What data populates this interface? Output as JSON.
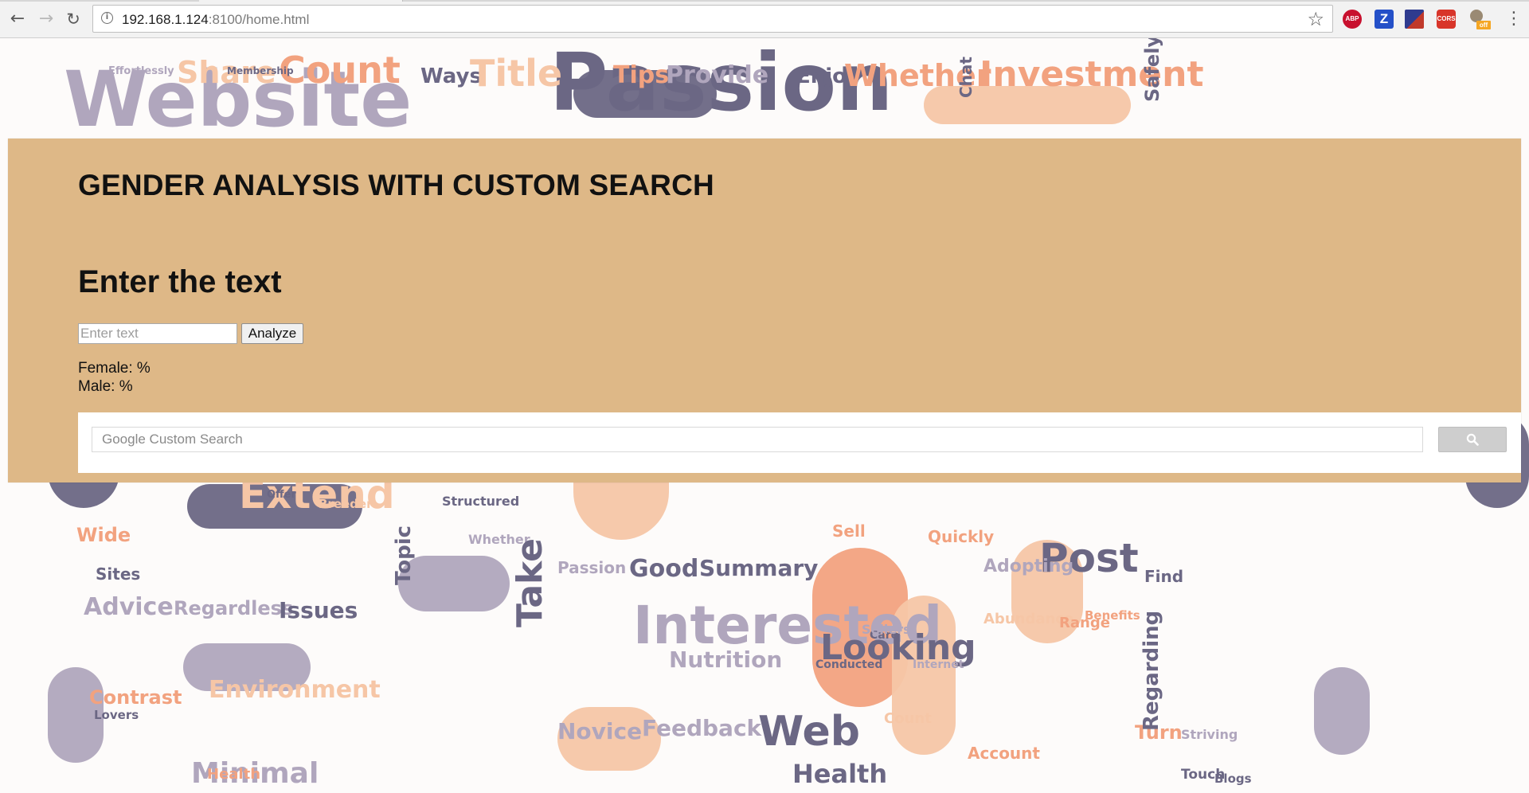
{
  "browser": {
    "url_host": "192.168.1.124",
    "url_rest": ":8100/home.html",
    "nav": {
      "back_icon": "arrow-left-icon",
      "forward_icon": "arrow-right-icon",
      "reload_icon": "reload-icon"
    },
    "extensions": {
      "abp": "ABP",
      "z": "Z",
      "cors": "CORS",
      "cookie_badge": "off"
    }
  },
  "wordcloud": {
    "colors": {
      "slate": "#6b6784",
      "lilac": "#b0a6bd",
      "peach": "#f6c6a6",
      "salmon": "#f2a27f",
      "coral": "#ec9474"
    },
    "words": [
      {
        "t": "Passion",
        "c": "slate"
      },
      {
        "t": "Website",
        "c": "lilac"
      },
      {
        "t": "Count",
        "c": "salmon"
      },
      {
        "t": "Share",
        "c": "peach"
      },
      {
        "t": "Ways",
        "c": "slate"
      },
      {
        "t": "Title",
        "c": "peach"
      },
      {
        "t": "Tips",
        "c": "salmon"
      },
      {
        "t": "Provide",
        "c": "lilac"
      },
      {
        "t": "Enjoy",
        "c": "slate"
      },
      {
        "t": "Whether",
        "c": "salmon"
      },
      {
        "t": "Chat",
        "c": "slate"
      },
      {
        "t": "Investment",
        "c": "salmon"
      },
      {
        "t": "Safely",
        "c": "slate"
      },
      {
        "t": "Effortlessly",
        "c": "lilac"
      },
      {
        "t": "Membership",
        "c": "slate"
      },
      {
        "t": "Wide",
        "c": "salmon"
      },
      {
        "t": "Extend",
        "c": "peach"
      },
      {
        "t": "Offer",
        "c": "slate"
      },
      {
        "t": "Breeder",
        "c": "peach"
      },
      {
        "t": "Structured",
        "c": "slate"
      },
      {
        "t": "Whether",
        "c": "lilac"
      },
      {
        "t": "Passion",
        "c": "lilac"
      },
      {
        "t": "Good",
        "c": "slate"
      },
      {
        "t": "Summary",
        "c": "slate"
      },
      {
        "t": "Quickly",
        "c": "salmon"
      },
      {
        "t": "Post",
        "c": "slate"
      },
      {
        "t": "Adopting",
        "c": "lilac"
      },
      {
        "t": "Interested",
        "c": "lilac"
      },
      {
        "t": "Looking",
        "c": "slate"
      },
      {
        "t": "Nutrition",
        "c": "lilac"
      },
      {
        "t": "Advice",
        "c": "lilac"
      },
      {
        "t": "Regardless",
        "c": "lilac"
      },
      {
        "t": "Issues",
        "c": "slate"
      },
      {
        "t": "Environment",
        "c": "peach"
      },
      {
        "t": "Contrast",
        "c": "salmon"
      },
      {
        "t": "Lovers",
        "c": "slate"
      },
      {
        "t": "Take",
        "c": "slate"
      },
      {
        "t": "Novice",
        "c": "lilac"
      },
      {
        "t": "Feedback",
        "c": "lilac"
      },
      {
        "t": "Web",
        "c": "slate"
      },
      {
        "t": "Health",
        "c": "slate"
      },
      {
        "t": "Count",
        "c": "peach"
      },
      {
        "t": "Account",
        "c": "salmon"
      },
      {
        "t": "Turn",
        "c": "salmon"
      },
      {
        "t": "Abundance",
        "c": "peach"
      },
      {
        "t": "Benefits",
        "c": "salmon"
      },
      {
        "t": "Find",
        "c": "slate"
      },
      {
        "t": "Regarding",
        "c": "slate"
      },
      {
        "t": "Striving",
        "c": "lilac"
      },
      {
        "t": "Touch",
        "c": "slate"
      },
      {
        "t": "Blogs",
        "c": "slate"
      },
      {
        "t": "Conducted",
        "c": "slate"
      },
      {
        "t": "Internet",
        "c": "lilac"
      },
      {
        "t": "Sites",
        "c": "slate"
      },
      {
        "t": "Topic",
        "c": "slate"
      },
      {
        "t": "Care",
        "c": "slate"
      },
      {
        "t": "Range",
        "c": "salmon"
      },
      {
        "t": "Sellers",
        "c": "lilac"
      },
      {
        "t": "Sell",
        "c": "salmon"
      },
      {
        "t": "Minimal",
        "c": "lilac"
      },
      {
        "t": "Health",
        "c": "salmon"
      }
    ]
  },
  "page": {
    "title": "GENDER ANALYSIS WITH CUSTOM SEARCH",
    "subtitle": "Enter the text",
    "input_placeholder": "Enter text",
    "analyze_label": "Analyze",
    "female_label": "Female: %",
    "male_label": "Male: %"
  },
  "cse": {
    "placeholder": "Google Custom Search",
    "search_icon": "magnifier-icon"
  }
}
